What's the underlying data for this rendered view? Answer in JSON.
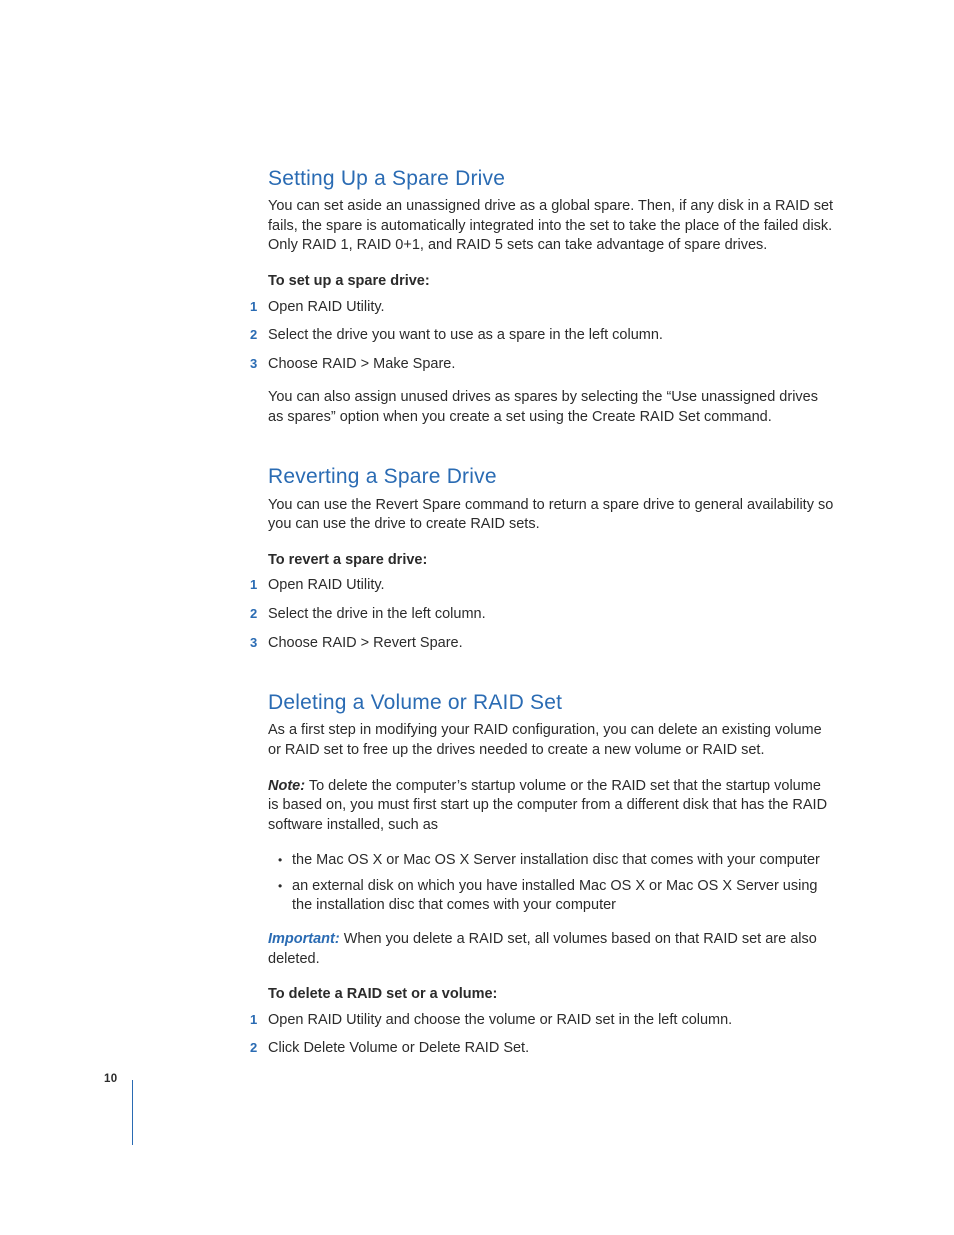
{
  "page_number": "10",
  "sections": [
    {
      "heading": "Setting Up a Spare Drive",
      "intro": "You can set aside an unassigned drive as a global spare. Then, if any disk in a RAID set fails, the spare is automatically integrated into the set to take the place of the failed disk. Only RAID 1, RAID 0+1, and RAID 5 sets can take advantage of spare drives.",
      "task_head": "To set up a spare drive:",
      "steps": [
        "Open RAID Utility.",
        "Select the drive you want to use as a spare in the left column.",
        "Choose RAID > Make Spare."
      ],
      "after": "You can also assign unused drives as spares by selecting the “Use unassigned drives as spares” option when you create a set using the Create RAID Set command."
    },
    {
      "heading": "Reverting a Spare Drive",
      "intro": "You can use the Revert Spare command to return a spare drive to general availability so you can use the drive to create RAID sets.",
      "task_head": "To revert a spare drive:",
      "steps": [
        "Open RAID Utility.",
        "Select the drive in the left column.",
        "Choose RAID > Revert Spare."
      ]
    },
    {
      "heading": "Deleting a Volume or RAID Set",
      "intro": "As a first step in modifying your RAID configuration, you can delete an existing volume or RAID set to free up the drives needed to create a new volume or RAID set.",
      "note_label": "Note:",
      "note_body": "  To delete the computer’s startup volume or the RAID set that the startup volume is based on, you must first start up the computer from a different disk that has the RAID software installed, such as",
      "bullets": [
        "the Mac OS X or Mac OS X Server installation disc that comes with your computer",
        "an external disk on which you have installed Mac OS X or Mac OS X Server using the installation disc that comes with your computer"
      ],
      "important_label": "Important:",
      "important_body": "  When you delete a RAID set, all volumes based on that RAID set are also deleted.",
      "task_head": "To delete a RAID set or a volume:",
      "steps": [
        "Open RAID Utility and choose the volume or RAID set in the left column.",
        "Click Delete Volume or Delete RAID Set."
      ]
    }
  ]
}
